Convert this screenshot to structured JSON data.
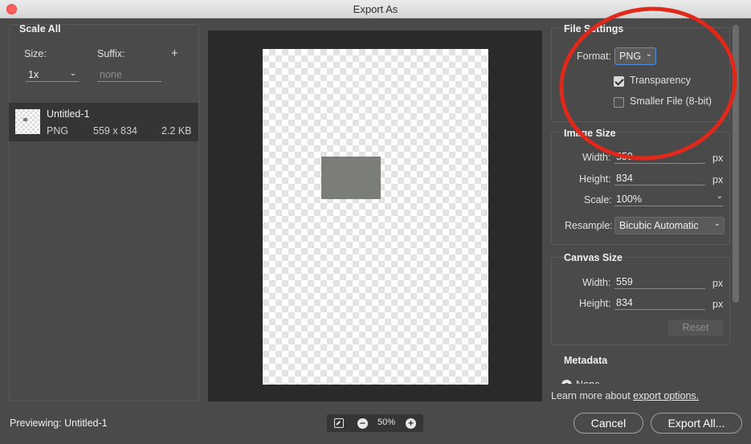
{
  "window": {
    "title": "Export As"
  },
  "scale_panel": {
    "title": "Scale All",
    "size_label": "Size:",
    "suffix_label": "Suffix:",
    "add_symbol": "+",
    "size_value": "1x",
    "suffix_placeholder": "none"
  },
  "asset": {
    "name": "Untitled-1",
    "format": "PNG",
    "dimensions": "559 x 834",
    "file_size": "2.2 KB"
  },
  "file_settings": {
    "title": "File Settings",
    "format_label": "Format:",
    "format_value": "PNG",
    "transparency_label": "Transparency",
    "transparency_checked": true,
    "smaller_file_label": "Smaller File (8-bit)",
    "smaller_file_checked": false
  },
  "image_size": {
    "title": "Image Size",
    "width_label": "Width:",
    "width_value": "559",
    "height_label": "Height:",
    "height_value": "834",
    "scale_label": "Scale:",
    "scale_value": "100%",
    "resample_label": "Resample:",
    "resample_value": "Bicubic Automatic",
    "unit": "px"
  },
  "canvas_size": {
    "title": "Canvas Size",
    "width_label": "Width:",
    "width_value": "559",
    "height_label": "Height:",
    "height_value": "834",
    "unit": "px",
    "reset_label": "Reset"
  },
  "metadata": {
    "title": "Metadata",
    "option_none": "None"
  },
  "footer": {
    "learn_more_text": "Learn more about ",
    "learn_more_link": "export options.",
    "previewing_text": "Previewing: Untitled-1",
    "zoom_value": "50%",
    "cancel_label": "Cancel",
    "export_label": "Export All..."
  },
  "colors": {
    "highlight_circle": "#e0281b",
    "dialog_background": "#4a4a4a",
    "preview_background": "#2a2a2a"
  }
}
